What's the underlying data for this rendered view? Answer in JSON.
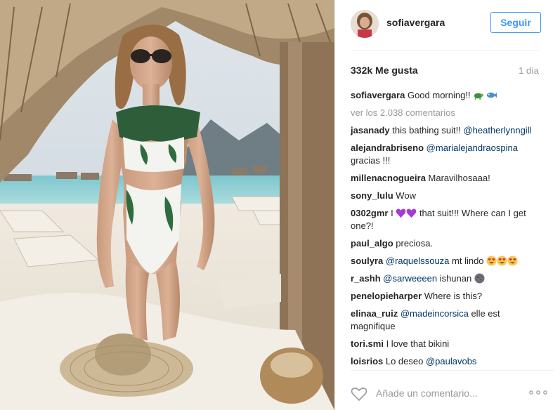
{
  "post": {
    "username": "sofiavergara",
    "follow_label": "Seguir",
    "likes": "332k Me gusta",
    "time": "1 día",
    "caption_user": "sofiavergara",
    "caption_text": "Good morning!!",
    "view_all": "ver los 2.038 comentarios"
  },
  "comments": [
    {
      "user": "jasanady",
      "parts": [
        {
          "t": " this bathing suit!! "
        },
        {
          "m": "@heatherlynngill"
        }
      ]
    },
    {
      "user": "alejandrabriseno",
      "parts": [
        {
          "t": " "
        },
        {
          "m": "@marialejandraospina"
        },
        {
          "t": " gracias !!!"
        }
      ]
    },
    {
      "user": "millenacnogueira",
      "parts": [
        {
          "t": " Maravilhosaaa!"
        }
      ]
    },
    {
      "user": "sony_lulu",
      "parts": [
        {
          "t": " Wow"
        }
      ]
    },
    {
      "user": "0302gmr",
      "parts": [
        {
          "t": " I "
        },
        {
          "e": "purple-heart"
        },
        {
          "e": "purple-heart"
        },
        {
          "t": " that suit!!! Where can I get one?!"
        }
      ]
    },
    {
      "user": "paul_algo",
      "parts": [
        {
          "t": " preciosa."
        }
      ]
    },
    {
      "user": "soulyra",
      "parts": [
        {
          "t": " "
        },
        {
          "m": "@raquelssouza"
        },
        {
          "t": " mt lindo "
        },
        {
          "e": "heart-eyes"
        },
        {
          "e": "heart-eyes"
        },
        {
          "e": "heart-eyes"
        }
      ]
    },
    {
      "user": "r_ashh",
      "parts": [
        {
          "t": " "
        },
        {
          "m": "@sarweeeen"
        },
        {
          "t": " ishunan "
        },
        {
          "e": "moon"
        }
      ]
    },
    {
      "user": "penelopieharper",
      "parts": [
        {
          "t": " Where is this?"
        }
      ]
    },
    {
      "user": "elinaa_ruiz",
      "parts": [
        {
          "t": " "
        },
        {
          "m": "@madeincorsica"
        },
        {
          "t": " elle est magnifique"
        }
      ]
    },
    {
      "user": "tori.smi",
      "parts": [
        {
          "t": " I love that bikini"
        }
      ]
    },
    {
      "user": "loisrios",
      "parts": [
        {
          "t": " Lo deseo "
        },
        {
          "m": "@paulavobs"
        }
      ]
    }
  ],
  "footer": {
    "comment_placeholder": "Añade un comentario..."
  },
  "icons": {
    "heart": "heart-outline-icon",
    "more": "more-options-icon"
  },
  "colors": {
    "accent": "#3897f0",
    "mention": "#003569",
    "muted": "#999999"
  }
}
